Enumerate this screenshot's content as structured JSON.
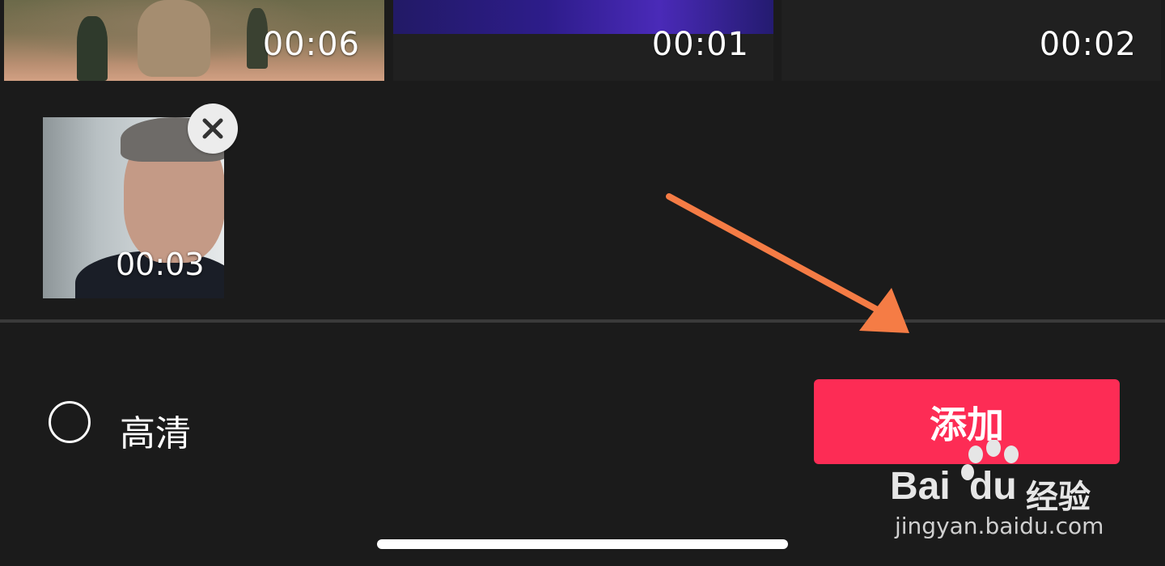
{
  "media_grid": {
    "tiles": [
      {
        "duration": "00:06"
      },
      {
        "duration": "00:01"
      },
      {
        "duration": "00:02"
      }
    ]
  },
  "selected": {
    "items": [
      {
        "duration": "00:03"
      }
    ]
  },
  "bottom_bar": {
    "hd_label": "高清",
    "add_label": "添加"
  },
  "watermark": {
    "brand_left": "Bai",
    "brand_mid": "du",
    "brand_right": "经验",
    "url": "jingyan.baidu.com"
  },
  "colors": {
    "background": "#1b1b1b",
    "add_button": "#fd2c55",
    "annotation_arrow": "#f57c45"
  },
  "icons": {
    "remove": "close-icon",
    "hd_toggle": "radio-circle-icon",
    "annotation": "arrow-icon"
  }
}
